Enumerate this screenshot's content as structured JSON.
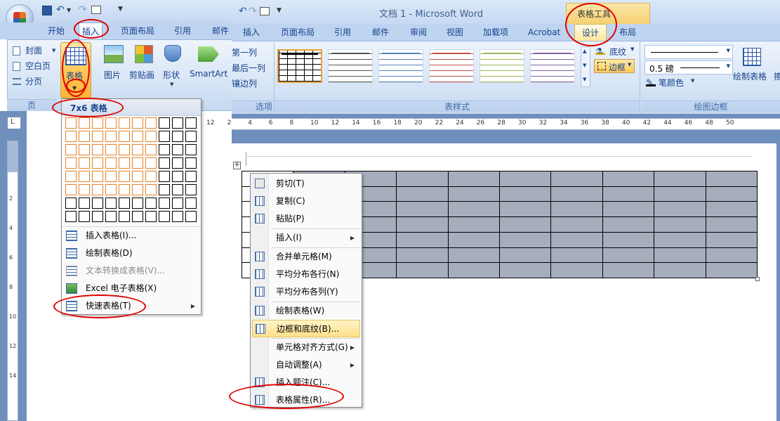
{
  "back_window": {
    "tabs": [
      "开始",
      "插入",
      "页面布局",
      "引用",
      "邮件"
    ],
    "active_tab": "插入",
    "page_group": {
      "items": [
        "封面",
        "空白页",
        "分页"
      ],
      "label": "页"
    },
    "table_button": "表格",
    "insert_buttons": [
      "图片",
      "剪贴画",
      "形状",
      "SmartArt"
    ],
    "grid_title": "7x6 表格",
    "grid": {
      "cols": 10,
      "rows": 8,
      "sel_cols": 7,
      "sel_rows": 6
    },
    "menu": [
      {
        "label": "插入表格(I)...",
        "icon": "insert-table-icon",
        "disabled": false
      },
      {
        "label": "绘制表格(D)",
        "icon": "draw-table-icon",
        "disabled": false
      },
      {
        "label": "文本转换成表格(V)...",
        "icon": "convert-text-icon",
        "disabled": true
      },
      {
        "label": "Excel 电子表格(X)",
        "icon": "excel-icon",
        "disabled": false
      },
      {
        "label": "快速表格(T)",
        "icon": "quick-table-icon",
        "disabled": false,
        "submenu": true
      }
    ],
    "left_ruler_nums": [
      "2",
      "4",
      "6",
      "8",
      "10",
      "12",
      "14"
    ]
  },
  "front_window": {
    "title": "文档 1 - Microsoft Word",
    "context_label": "表格工具",
    "tabs": [
      "插入",
      "页面布局",
      "引用",
      "邮件",
      "审阅",
      "视图",
      "加载项",
      "Acrobat",
      "设计",
      "布局"
    ],
    "active_tab": "设计",
    "options_items": [
      "第一列",
      "最后一列",
      "镶边列"
    ],
    "options_group_label": "选项",
    "table_styles_label": "表样式",
    "style_colors": [
      "#000000",
      "#555555",
      "#4f81bd",
      "#c0504d",
      "#9bbb59",
      "#8064a2"
    ],
    "shading_label": "底纹",
    "borders_label": "边框",
    "line_weight": "0.5 磅",
    "pen_color_label": "笔颜色",
    "draw_table_label": "绘制表格",
    "eraser_label": "擦",
    "draw_borders_label": "绘图边框",
    "ruler_nums": [
      "12",
      "2",
      "4",
      "6",
      "8",
      "10",
      "12",
      "14",
      "16",
      "18",
      "20",
      "22",
      "24",
      "26",
      "28",
      "30",
      "32",
      "34",
      "36",
      "38",
      "40",
      "42",
      "44",
      "46",
      "48",
      "50"
    ]
  },
  "context_menu": [
    {
      "label": "剪切(T)",
      "icon": "scissors-icon"
    },
    {
      "label": "复制(C)",
      "icon": "copy-icon"
    },
    {
      "label": "粘贴(P)",
      "icon": "paste-icon"
    },
    {
      "label": "插入(I)",
      "icon": "",
      "submenu": true
    },
    {
      "label": "合并单元格(M)",
      "icon": "merge-cells-icon"
    },
    {
      "label": "平均分布各行(N)",
      "icon": "distribute-rows-icon"
    },
    {
      "label": "平均分布各列(Y)",
      "icon": "distribute-cols-icon"
    },
    {
      "label": "绘制表格(W)",
      "icon": "draw-table-icon"
    },
    {
      "label": "边框和底纹(B)...",
      "icon": "borders-shading-icon",
      "highlight": true
    },
    {
      "label": "单元格对齐方式(G)",
      "icon": "",
      "submenu": true
    },
    {
      "label": "自动调整(A)",
      "icon": "",
      "submenu": true
    },
    {
      "label": "插入题注(C)...",
      "icon": "caption-icon"
    },
    {
      "label": "表格属性(R)...",
      "icon": "table-properties-icon"
    }
  ],
  "doc_table": {
    "rows": 7,
    "cols": 10
  }
}
